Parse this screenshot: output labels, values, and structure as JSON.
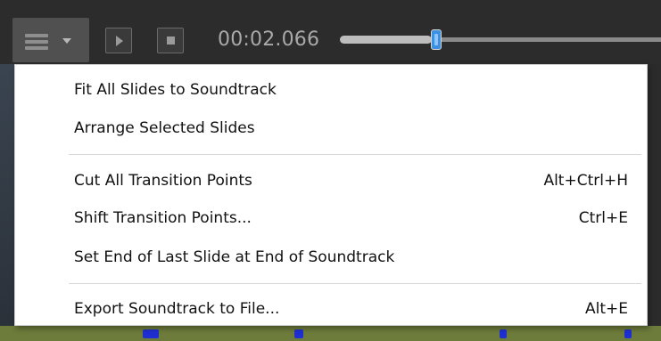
{
  "toolbar": {
    "time": "00:02.066",
    "slider_position": 0.28
  },
  "menu": {
    "items": [
      {
        "label": "Fit All Slides to Soundtrack",
        "shortcut": ""
      },
      {
        "label": "Arrange Selected Slides",
        "shortcut": ""
      },
      {
        "label": "Cut All Transition Points",
        "shortcut": "Alt+Ctrl+H"
      },
      {
        "label": "Shift Transition Points...",
        "shortcut": "Ctrl+E"
      },
      {
        "label": "Set End of Last Slide at End of Soundtrack",
        "shortcut": ""
      },
      {
        "label": "Export Soundtrack to File...",
        "shortcut": "Alt+E"
      }
    ]
  },
  "icons": {
    "menu_button": "hamburger-icon",
    "dropdown": "chevron-down-icon",
    "play": "play-icon",
    "stop": "stop-icon"
  },
  "colors": {
    "slider_thumb": "#3d8fe0",
    "menu_bg": "#ffffff",
    "toolbar_bg": "#2c2c2c"
  }
}
